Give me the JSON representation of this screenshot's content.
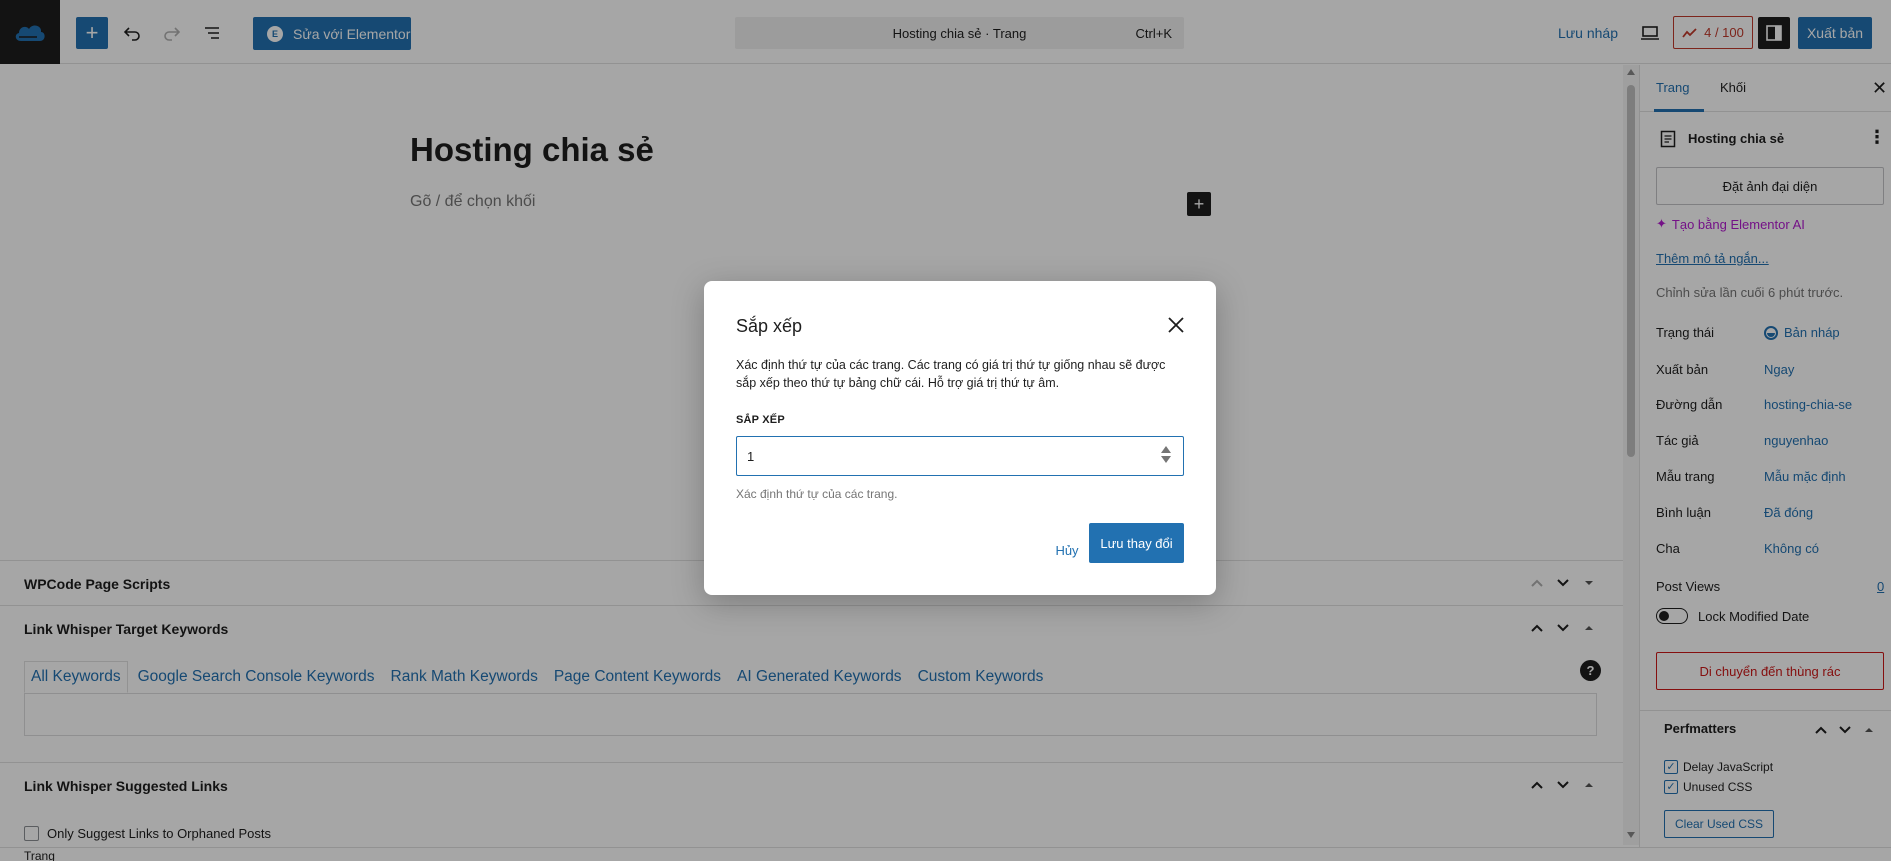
{
  "topbar": {
    "elementor_label": "Sửa với Elementor",
    "command_title": "Hosting chia sẻ · Trang",
    "command_shortcut": "Ctrl+K",
    "save_draft": "Lưu nháp",
    "rank_score": "4 / 100",
    "publish": "Xuất bản"
  },
  "editor": {
    "title": "Hosting chia sẻ",
    "placeholder": "Gõ / để chọn khối"
  },
  "metaboxes": {
    "wpcode": "WPCode Page Scripts",
    "target_keywords": "Link Whisper Target Keywords",
    "keyword_tabs": [
      "All Keywords",
      "Google Search Console Keywords",
      "Rank Math Keywords",
      "Page Content Keywords",
      "AI Generated Keywords",
      "Custom Keywords"
    ],
    "suggested_links": "Link Whisper Suggested Links",
    "orphaned_label": "Only Suggest Links to Orphaned Posts",
    "footer_crumb": "Trang"
  },
  "sidebar": {
    "tab_page": "Trang",
    "tab_block": "Khối",
    "doc_title": "Hosting chia sẻ",
    "featured_image": "Đặt ảnh đại diện",
    "ai_link": "Tạo bằng Elementor AI",
    "excerpt_link": "Thêm mô tả ngắn...",
    "last_edited": "Chỉnh sửa lần cuối 6 phút trước.",
    "rows": [
      {
        "label": "Trạng thái",
        "value": "Bản nháp"
      },
      {
        "label": "Xuất bản",
        "value": "Ngay"
      },
      {
        "label": "Đường dẫn",
        "value": "hosting-chia-se"
      },
      {
        "label": "Tác giả",
        "value": "nguyenhao"
      },
      {
        "label": "Mẫu trang",
        "value": "Mẫu mặc định"
      },
      {
        "label": "Bình luận",
        "value": "Đã đóng"
      },
      {
        "label": "Cha",
        "value": "Không có"
      }
    ],
    "post_views_label": "Post Views",
    "post_views_value": "0",
    "lock_modified": "Lock Modified Date",
    "trash": "Di chuyển đến thùng rác",
    "perfmatters": "Perfmatters",
    "delay_js": "Delay JavaScript",
    "unused_css": "Unused CSS",
    "clear_css": "Clear Used CSS"
  },
  "modal": {
    "title": "Sắp xếp",
    "description": "Xác định thứ tự của các trang. Các trang có giá trị thứ tự giống nhau sẽ được sắp xếp theo thứ tự bảng chữ cái. Hỗ trợ giá trị thứ tự âm.",
    "field_label": "SẮP XẾP",
    "field_value": "1",
    "help": "Xác định thứ tự của các trang.",
    "cancel": "Hủy",
    "save": "Lưu thay đổi"
  },
  "colors": {
    "accent": "#2271b1",
    "danger": "#cc1818",
    "ai": "#b21bcf"
  }
}
